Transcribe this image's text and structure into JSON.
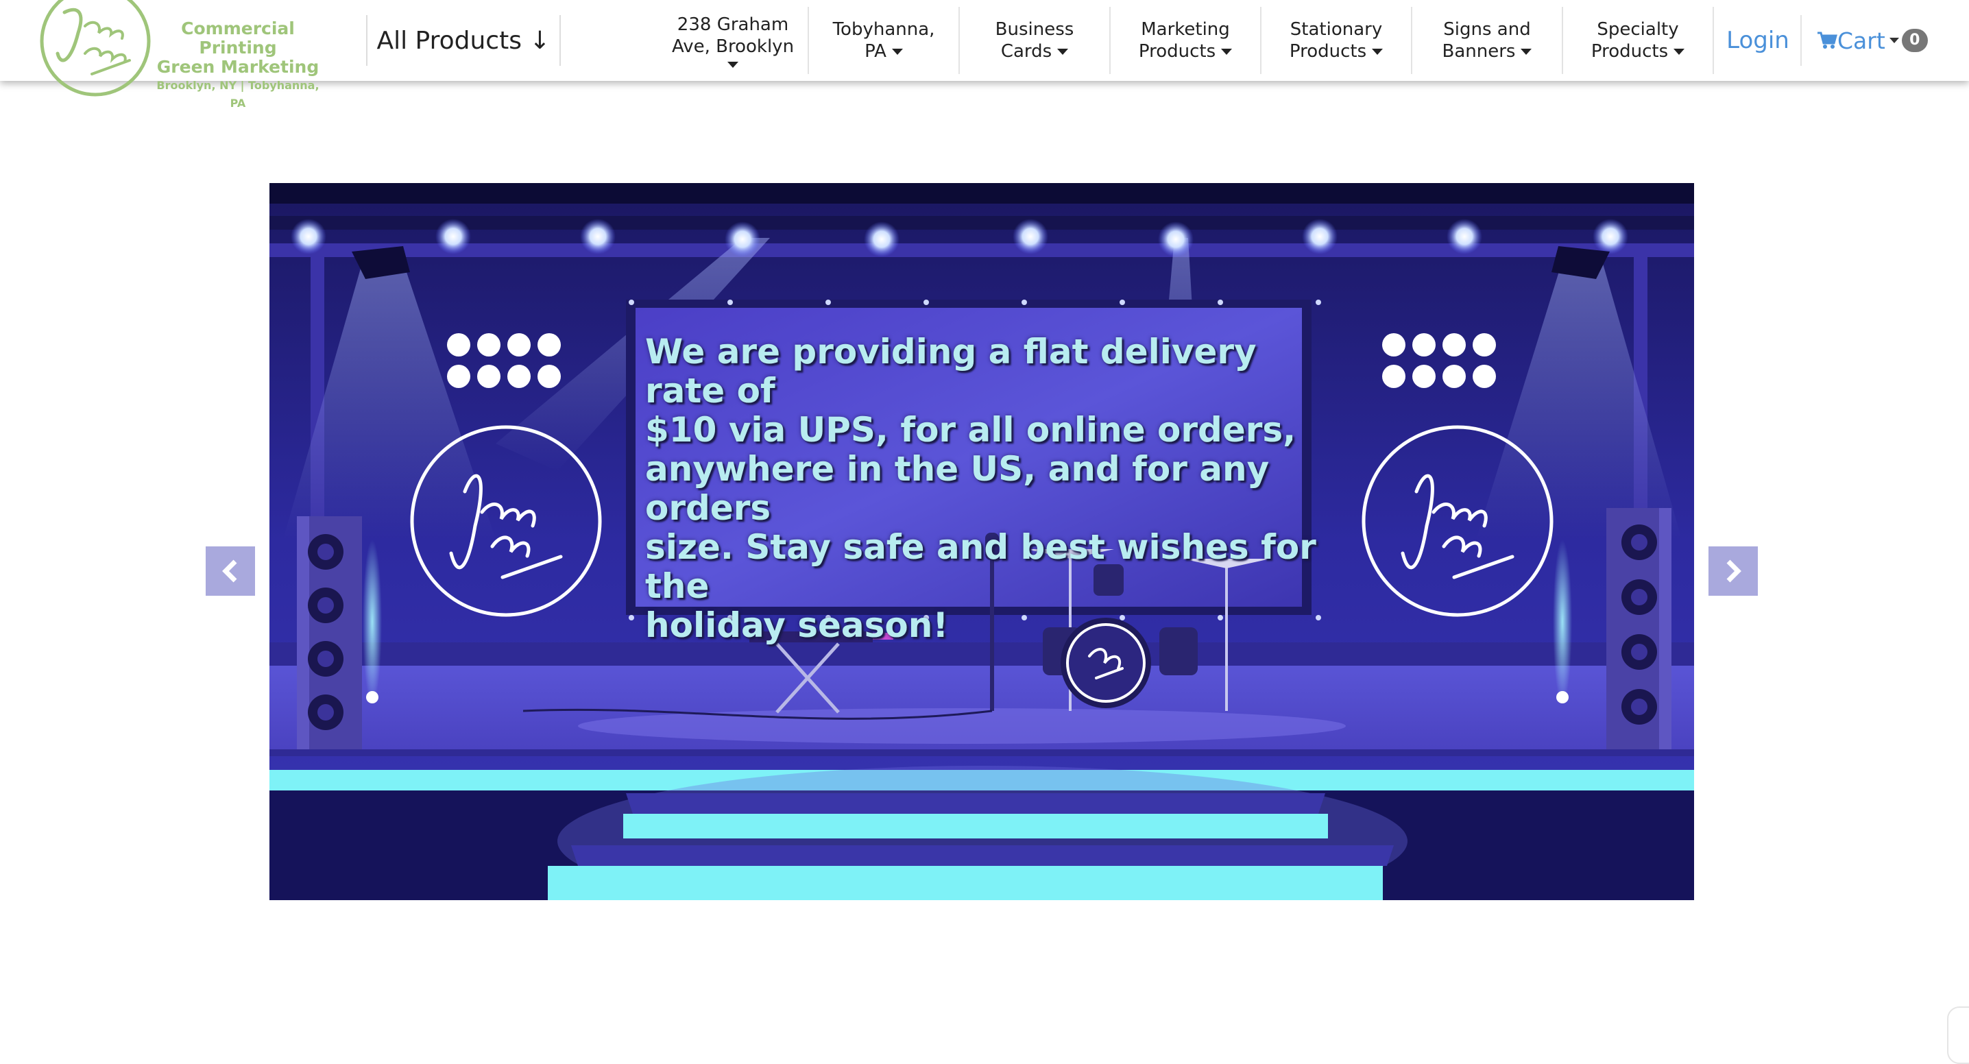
{
  "header": {
    "logo": {
      "script_text": "Jazz'n print",
      "line1": "Commercial Printing",
      "line2": "Green Marketing",
      "line3": "Brooklyn, NY  |  Tobyhanna, PA"
    },
    "all_products_label": "All Products ↓",
    "nav": [
      {
        "line1": "238 Graham",
        "line2": "Ave, Brooklyn"
      },
      {
        "line1": "Tobyhanna,",
        "line2": "PA"
      },
      {
        "line1": "Business",
        "line2": "Cards"
      },
      {
        "line1": "Marketing",
        "line2": "Products"
      },
      {
        "line1": "Stationary",
        "line2": "Products"
      },
      {
        "line1": "Signs and",
        "line2": "Banners"
      },
      {
        "line1": "Specialty",
        "line2": "Products"
      }
    ],
    "login_label": "Login",
    "cart_label": "Cart",
    "cart_count": "0"
  },
  "slider": {
    "banner_text": "We are providing a flat delivery rate of\n$10 via UPS, for all online orders,\nanywhere in the US, and for any orders\nsize.  Stay safe and best wishes for the\nholiday season!",
    "logo_script": "Jazz'n print",
    "prev_icon": "chevron-left",
    "next_icon": "chevron-right"
  },
  "colors": {
    "logo_green": "#9fc57a",
    "link_blue": "#4a90d9",
    "stage_dark": "#12114a",
    "stage_purple": "#4a3fc0",
    "neon_cyan": "#7ef2f7",
    "banner_text": "#b8ecf0"
  }
}
